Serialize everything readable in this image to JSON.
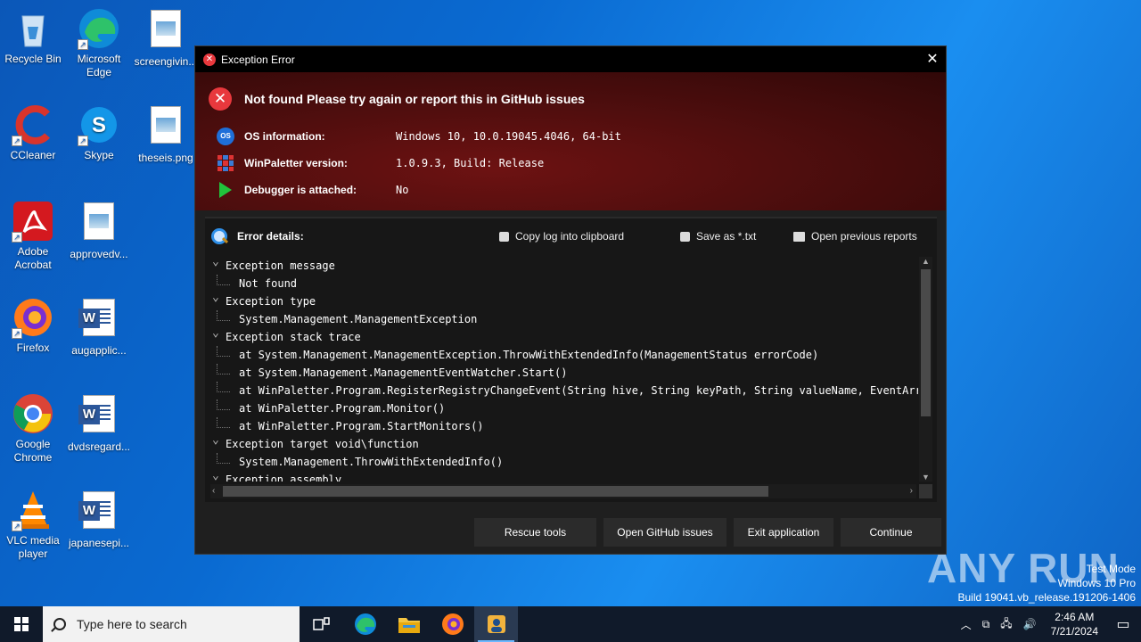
{
  "desktop": {
    "icons": [
      {
        "label": "Recycle Bin"
      },
      {
        "label": "Microsoft Edge"
      },
      {
        "label": "screengivin..."
      },
      {
        "label": "CCleaner"
      },
      {
        "label": "Skype"
      },
      {
        "label": "theseis.png"
      },
      {
        "label": "Adobe Acrobat"
      },
      {
        "label": "approvedv..."
      },
      {
        "label": "Firefox"
      },
      {
        "label": "augapplic..."
      },
      {
        "label": "Google Chrome"
      },
      {
        "label": "dvdsregard..."
      },
      {
        "label": "VLC media player"
      },
      {
        "label": "japanesepi..."
      }
    ]
  },
  "dialog": {
    "title": "Exception Error",
    "close_glyph": "✕",
    "header": {
      "message": "Not found  Please try again or report this in GitHub issues",
      "rows": [
        {
          "key": "OS information:",
          "value": "Windows 10, 10.0.19045.4046, 64-bit",
          "icon": "os-icon",
          "icon_text": "OS"
        },
        {
          "key": "WinPaletter version:",
          "value": "1.0.9.3, Build: Release",
          "icon": "winpaletter-icon"
        },
        {
          "key": "Debugger is attached:",
          "value": "No",
          "icon": "play-icon"
        }
      ]
    },
    "details": {
      "title": "Error details:",
      "copy_label": "Copy log into clipboard",
      "save_label": "Save as *.txt",
      "open_reports_label": "Open previous reports",
      "tree": [
        {
          "type": "parent",
          "text": "Exception message"
        },
        {
          "type": "child",
          "text": "Not found"
        },
        {
          "type": "parent",
          "text": "Exception type"
        },
        {
          "type": "child",
          "text": "System.Management.ManagementException"
        },
        {
          "type": "parent",
          "text": "Exception stack trace"
        },
        {
          "type": "child",
          "text": "at System.Management.ManagementException.ThrowWithExtendedInfo(ManagementStatus errorCode)"
        },
        {
          "type": "child",
          "text": "at System.Management.ManagementEventWatcher.Start()"
        },
        {
          "type": "child",
          "text": "at WinPaletter.Program.RegisterRegistryChangeEvent(String hive, String keyPath, String valueName, EventArrive"
        },
        {
          "type": "child",
          "text": "at WinPaletter.Program.Monitor()"
        },
        {
          "type": "child",
          "text": "at WinPaletter.Program.StartMonitors()"
        },
        {
          "type": "parent",
          "text": "Exception target void\\function"
        },
        {
          "type": "child",
          "text": "System.Management.ThrowWithExtendedInfo()"
        },
        {
          "type": "parent",
          "text": "Exception assembly"
        }
      ]
    },
    "buttons": {
      "rescue": "Rescue tools",
      "github": "Open GitHub issues",
      "exit": "Exit application",
      "continue": "Continue"
    }
  },
  "watermark": {
    "brand": "ANY RUN",
    "test_mode": "Test Mode",
    "edition": "Windows 10 Pro",
    "build": "Build 19041.vb_release.191206-1406"
  },
  "taskbar": {
    "search_placeholder": "Type here to search",
    "time": "2:46 AM",
    "date": "7/21/2024"
  },
  "colors": {
    "accent_error": "#e8383d",
    "dialog_bg": "#1f1f1f",
    "header_red": "#6d1212"
  }
}
